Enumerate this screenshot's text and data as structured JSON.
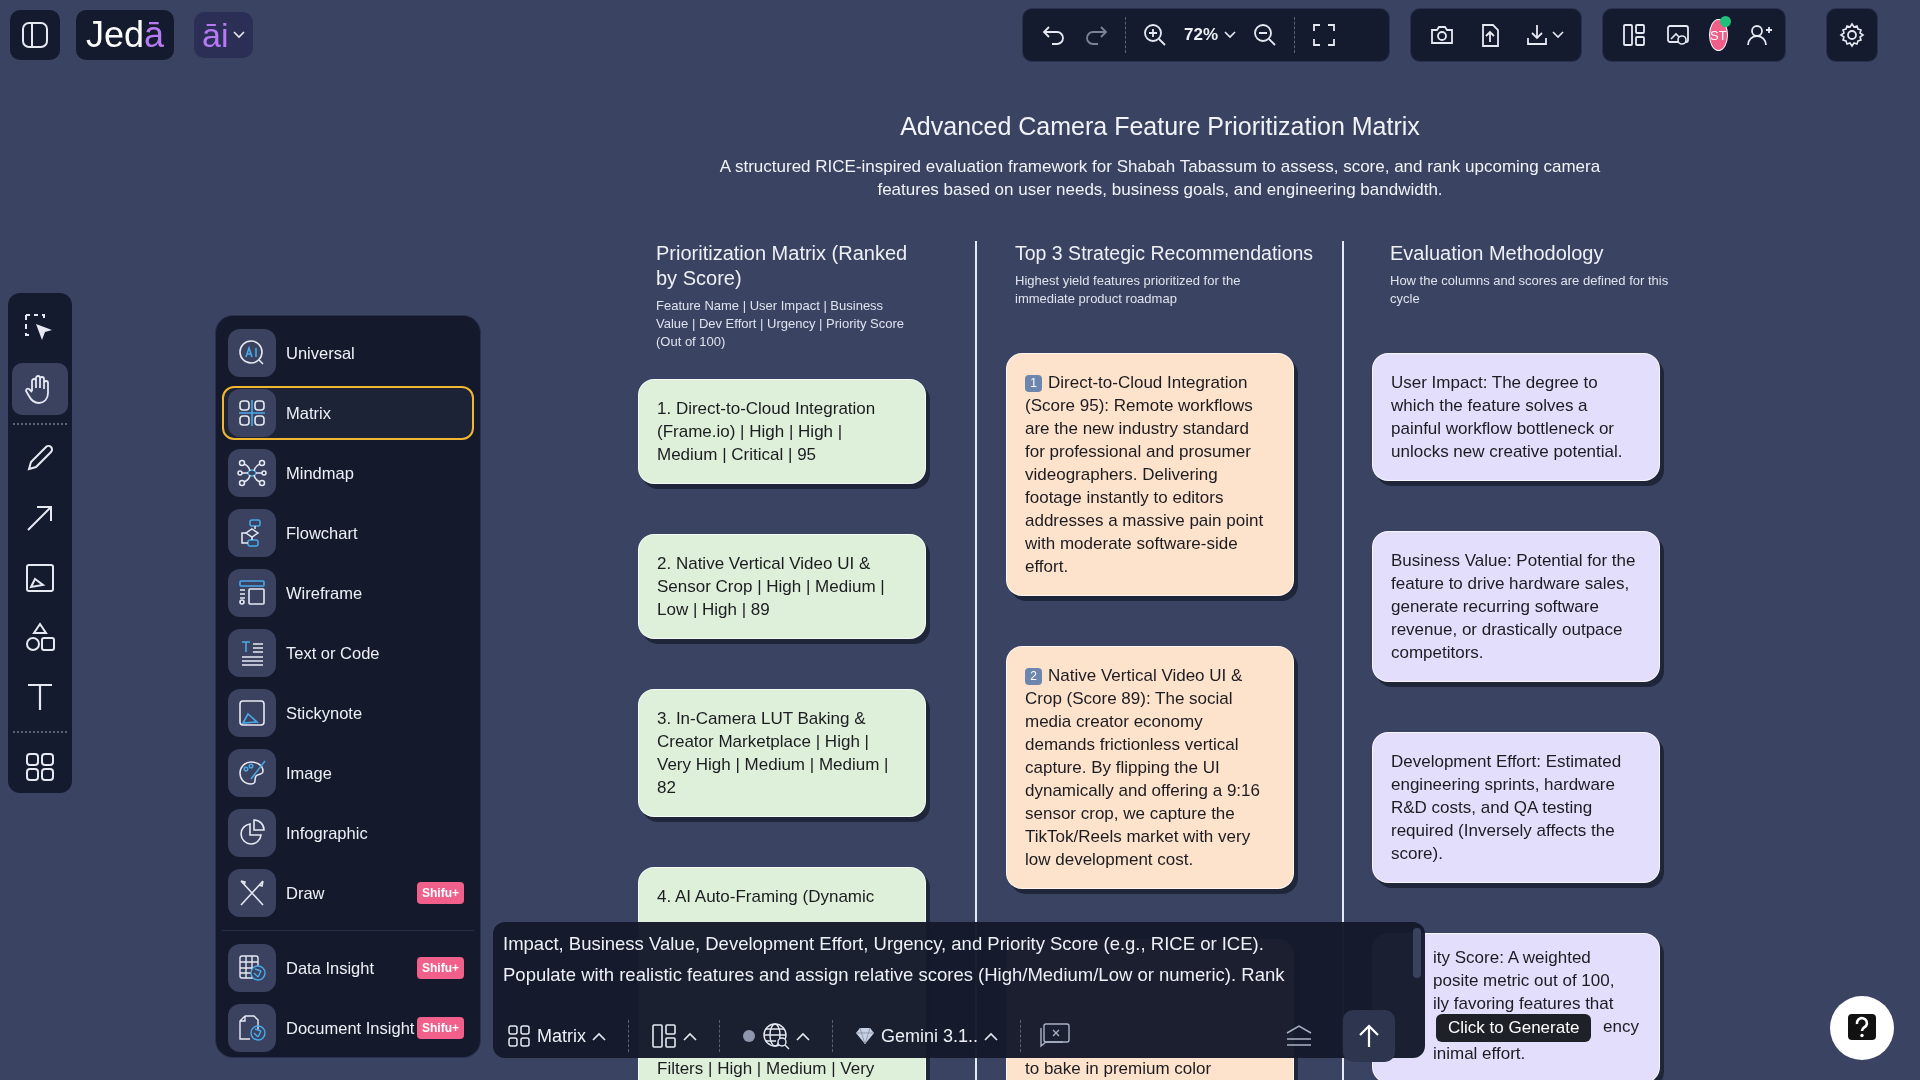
{
  "app": {
    "logo": "Jedā",
    "ai_label": "āi"
  },
  "toolbar": {
    "zoom": "72%",
    "user_initials": "ST",
    "user_online": true
  },
  "tools": [
    {
      "kind": "select",
      "selected": false
    },
    {
      "kind": "hand",
      "selected": true
    },
    {
      "kind": "pencil",
      "selected": false
    },
    {
      "kind": "arrow",
      "selected": false
    },
    {
      "kind": "image",
      "selected": false
    },
    {
      "kind": "shapes",
      "selected": false
    },
    {
      "kind": "text",
      "selected": false
    },
    {
      "kind": "apps",
      "selected": false
    }
  ],
  "menu": {
    "groups": [
      [
        {
          "label": "Universal",
          "kind": "universal",
          "selected": false
        },
        {
          "label": "Matrix",
          "kind": "matrix",
          "selected": true
        },
        {
          "label": "Mindmap",
          "kind": "mindmap",
          "selected": false
        },
        {
          "label": "Flowchart",
          "kind": "flowchart",
          "selected": false
        },
        {
          "label": "Wireframe",
          "kind": "wireframe",
          "selected": false
        },
        {
          "label": "Text or Code",
          "kind": "text",
          "selected": false
        },
        {
          "label": "Stickynote",
          "kind": "sticky",
          "selected": false
        },
        {
          "label": "Image",
          "kind": "image",
          "selected": false
        },
        {
          "label": "Infographic",
          "kind": "infographic",
          "selected": false
        },
        {
          "label": "Draw",
          "kind": "draw",
          "selected": false,
          "badge": "Shifu+"
        }
      ],
      [
        {
          "label": "Data Insight",
          "kind": "data",
          "selected": false,
          "badge": "Shifu+"
        },
        {
          "label": "Document Insight",
          "kind": "document",
          "selected": false,
          "badge": "Shifu+"
        }
      ]
    ]
  },
  "canvas": {
    "title": "Advanced Camera Feature Prioritization Matrix",
    "subtitle": "A structured RICE-inspired evaluation framework for Shabah Tabassum to assess, score, and rank upcoming camera features based on user needs, business goals, and engineering bandwidth.",
    "columns": [
      {
        "heading": "Prioritization Matrix (Ranked by Score)",
        "caption": "Feature Name | User Impact | Business Value | Dev Effort | Urgency | Priority Score (Out of 100)",
        "color": "#def0d9",
        "cards": [
          {
            "text": "1. Direct-to-Cloud Integration (Frame.io) | High | High | Medium | Critical | 95"
          },
          {
            "text": "2. Native Vertical Video UI & Sensor Crop | High | Medium | Low | High | 89"
          },
          {
            "text": "3. In-Camera LUT Baking & Creator Marketplace | High | Very High | Medium | Medium | 82"
          },
          {
            "text": "4. AI Auto-Framing (Dynamic",
            "tail": "Filters | High | Medium | Very"
          }
        ]
      },
      {
        "heading": "Top 3 Strategic Recommendations",
        "caption": "Highest yield features prioritized for the immediate product roadmap",
        "color": "#fde3cb",
        "cards": [
          {
            "number": "1",
            "text": "Direct-to-Cloud Integration (Score 95): Remote workflows are the new industry standard for professional and prosumer videographers. Delivering footage instantly to editors addresses a massive pain point with moderate software-side effort."
          },
          {
            "number": "2",
            "text": "Native Vertical Video UI & Crop (Score 89): The social media creator economy demands frictionless vertical capture. By flipping the UI dynamically and offering a 9:16 sensor crop, we capture the TikTok/Reels market with very low development cost."
          },
          {
            "tail": "to bake in premium color"
          }
        ]
      },
      {
        "heading": "Evaluation Methodology",
        "caption": "How the columns and scores are defined for this cycle",
        "color": "#e3defb",
        "cards": [
          {
            "text": "User Impact: The degree to which the feature solves a painful workflow bottleneck or unlocks new creative potential."
          },
          {
            "text": "Business Value: Potential for the feature to drive hardware sales, generate recurring software revenue, or drastically outpace competitors."
          },
          {
            "text": "Development Effort: Estimated engineering sprints, hardware R&D costs, and QA testing required (Inversely affects the score)."
          },
          {
            "lines": [
              "ity Score: A weighted",
              "posite metric out of 100,",
              "ily favoring features that",
              "ency",
              "inimal effort."
            ]
          }
        ]
      }
    ]
  },
  "prompt": {
    "lines": [
      "Impact, Business Value, Development Effort, Urgency, and Priority Score (e.g., RICE or ICE).",
      "Populate with realistic features and assign relative scores (High/Medium/Low or numeric). Rank"
    ],
    "mode": "Matrix",
    "model": "Gemini 3.1..",
    "tooltip": "Click to Generate"
  }
}
